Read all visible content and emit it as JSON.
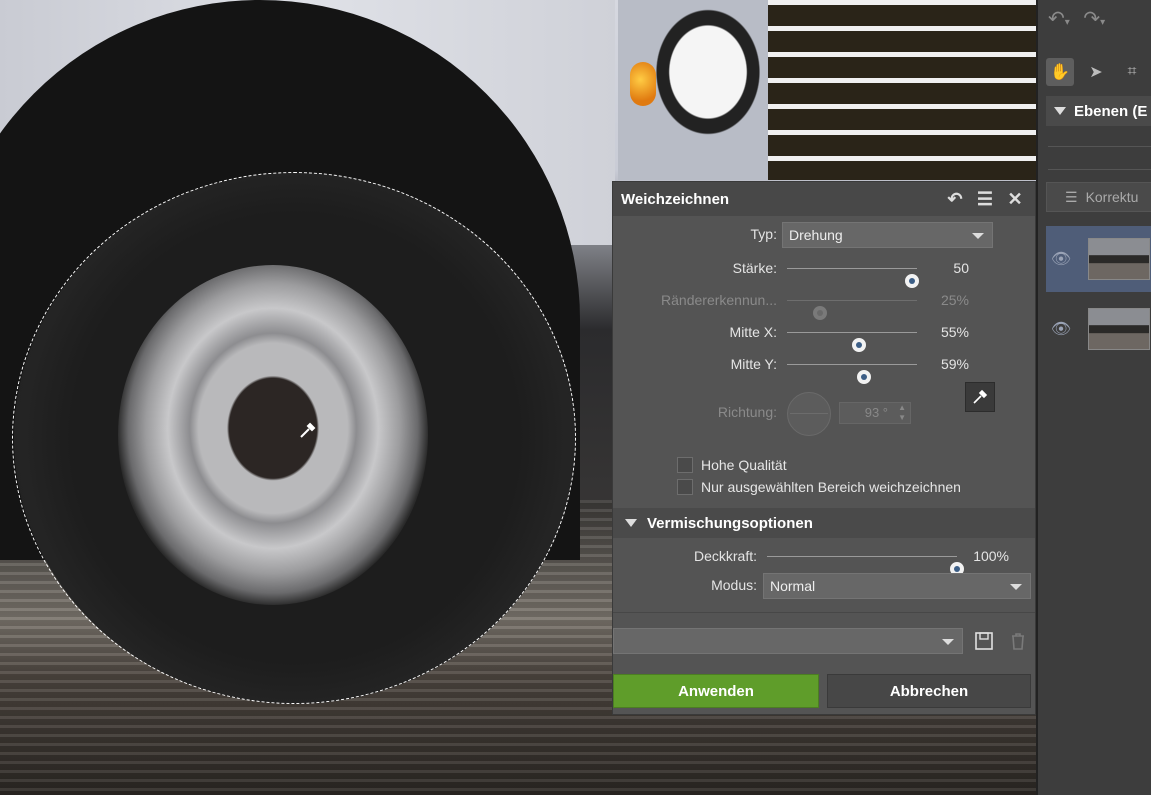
{
  "dialog": {
    "title": "Weichzeichnen",
    "type_label": "Typ:",
    "type_value": "Drehung",
    "strength": {
      "label": "Stärke:",
      "value": "50",
      "level": 0.96
    },
    "edge": {
      "label": "Rändererkennun...",
      "value": "25%",
      "level": 0.25
    },
    "center_x": {
      "label": "Mitte X:",
      "value": "55%",
      "level": 0.55
    },
    "center_y": {
      "label": "Mitte Y:",
      "value": "59%",
      "level": 0.59
    },
    "direction": {
      "label": "Richtung:",
      "value": "93 °"
    },
    "checkboxes": {
      "high_quality": "Hohe Qualität",
      "only_selected": "Nur ausgewählten Bereich weichzeichnen"
    },
    "blending": {
      "title": "Vermischungsoptionen",
      "opacity_label": "Deckkraft:",
      "opacity_value": "100%",
      "opacity_level": 1.0,
      "mode_label": "Modus:",
      "mode_value": "Normal"
    },
    "buttons": {
      "apply": "Anwenden",
      "cancel": "Abbrechen"
    },
    "accent_apply": "#5f9d2a"
  },
  "right_panel": {
    "layers_title": "Ebenen (E",
    "adjustment_label": "Korrektu"
  },
  "icons": {
    "undo": "undo-icon",
    "redo": "redo-icon",
    "hand": "hand-icon",
    "pointer": "pointer-icon",
    "crop": "crop-icon",
    "eye": "eye-icon",
    "pipette": "eyedropper-icon",
    "save": "save-icon",
    "trash": "trash-icon"
  }
}
